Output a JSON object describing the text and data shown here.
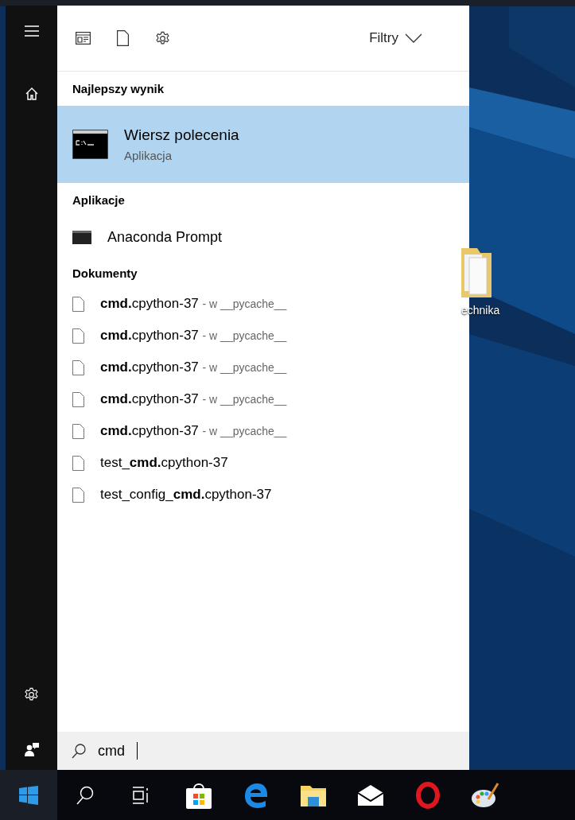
{
  "toolbar": {
    "filters": "Filtry"
  },
  "best_match": {
    "heading": "Najlepszy wynik",
    "item": {
      "title": "Wiersz polecenia",
      "subtitle": "Aplikacja",
      "selected": true
    }
  },
  "apps": {
    "heading": "Aplikacje",
    "items": [
      {
        "title": "Anaconda Prompt",
        "selected": false
      }
    ]
  },
  "documents": {
    "heading": "Dokumenty",
    "items": [
      {
        "name": "**cmd.**cpython-37",
        "location": "- w __pycache__"
      },
      {
        "name": "**cmd.**cpython-37",
        "location": "- w __pycache__"
      },
      {
        "name": "**cmd.**cpython-37",
        "location": "- w __pycache__"
      },
      {
        "name": "**cmd.**cpython-37",
        "location": "- w __pycache__"
      },
      {
        "name": "**cmd.**cpython-37",
        "location": "- w __pycache__"
      },
      {
        "name": "test_**cmd.**cpython-37"
      },
      {
        "name": "test_config_**cmd.**cpython-37"
      }
    ]
  },
  "search": {
    "value": "cmd"
  },
  "desktop": {
    "icon_label": "echnika"
  }
}
